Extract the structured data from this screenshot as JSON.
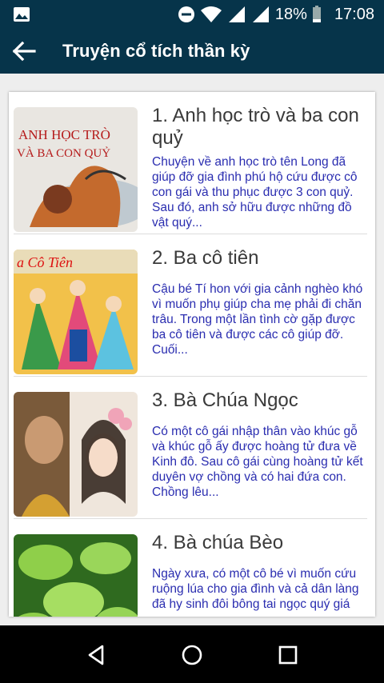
{
  "status": {
    "battery": "18%",
    "time": "17:08"
  },
  "appbar": {
    "title": "Truyện cổ tích thần kỳ"
  },
  "stories": [
    {
      "title": "1. Anh học trò và ba con quỷ",
      "summary": "Chuyện về anh học trò tên Long đã giúp đỡ gia đình phú hộ cứu được cô con gái và thu phục được 3 con quỷ. Sau đó, anh sở hữu được những đồ vật quý...",
      "thumb_text": "ANH HỌC TRÒ VÀ BA CON QUỶ"
    },
    {
      "title": "2. Ba cô tiên",
      "summary": "Cậu bé Tí hon với gia cảnh nghèo khó vì muốn phụ giúp cha mẹ phải đi chăn trâu. Trong một lần tình cờ gặp được ba cô tiên và được các cô giúp đỡ. Cuối...",
      "thumb_text": "a Cô Tiên"
    },
    {
      "title": "3. Bà Chúa Ngọc",
      "summary": "Có một cô gái nhập thân vào khúc gỗ và khúc gỗ ấy được hoàng tử đưa về Kinh đô. Sau cô gái cùng hoàng tử kết duyên vợ chồng và có hai đứa con. Chồng lêu..."
    },
    {
      "title": "4. Bà chúa Bèo",
      "summary": "Ngày xưa, có một cô bé vì muốn cứu ruộng lúa cho gia đình và cả dân làng đã hy sinh đôi bông tai ngọc quý giá"
    }
  ]
}
